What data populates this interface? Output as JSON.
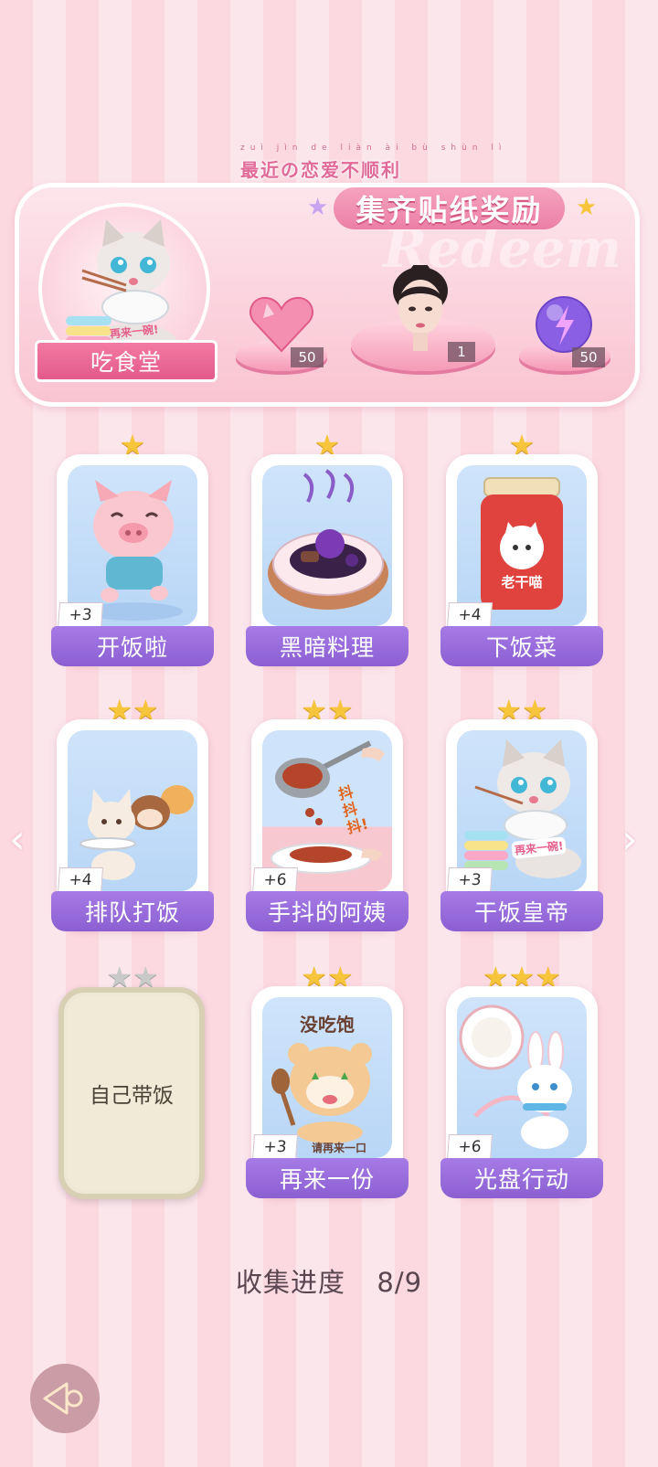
{
  "header": {
    "pinyin": "zuì jìn de liàn ài bù shùn lì",
    "title": "最近の恋爱不顺利",
    "reward_title": "集齐贴纸奖励",
    "watermark": "Redeem",
    "collection_name": "吃食堂",
    "sticker_text": "再来一碗!",
    "rewards": [
      {
        "icon": "heart-gem-icon",
        "count": "50"
      },
      {
        "icon": "character-portrait",
        "count": "1"
      },
      {
        "icon": "lightning-orb-icon",
        "count": "50"
      }
    ]
  },
  "cards": [
    {
      "label": "开饭啦",
      "stars": 1,
      "bonus": "+3",
      "art": "pig-running"
    },
    {
      "label": "黑暗料理",
      "stars": 1,
      "bonus": "",
      "art": "dark-cuisine-plate"
    },
    {
      "label": "下饭菜",
      "stars": 1,
      "bonus": "+4",
      "art": "chili-sauce-jar",
      "jar_text": "老干喵"
    },
    {
      "label": "排队打饭",
      "stars": 2,
      "bonus": "+4",
      "art": "animals-queue"
    },
    {
      "label": "手抖的阿姨",
      "stars": 2,
      "bonus": "+6",
      "art": "ladle-serving",
      "art_text": "抖抖抖!"
    },
    {
      "label": "干饭皇帝",
      "stars": 2,
      "bonus": "+3",
      "art": "cat-eating-rice",
      "art_text": "再来一碗!"
    },
    {
      "label": "自己带饭",
      "stars": 2,
      "bonus": "",
      "locked": true
    },
    {
      "label": "再来一份",
      "stars": 2,
      "bonus": "+3",
      "art": "hamster-hungry",
      "art_text_top": "没吃饱",
      "art_text_bottom": "请再来一口"
    },
    {
      "label": "光盘行动",
      "stars": 3,
      "bonus": "+6",
      "art": "bunny-plate"
    }
  ],
  "progress": {
    "label": "收集进度",
    "value": "8/9"
  },
  "nav": {
    "left_arrow": "‹",
    "right_arrow": "›"
  },
  "colors": {
    "accent_pink": "#ec7fa6",
    "card_purple": "#8b5fd1",
    "star_gold": "#f7c53b"
  }
}
